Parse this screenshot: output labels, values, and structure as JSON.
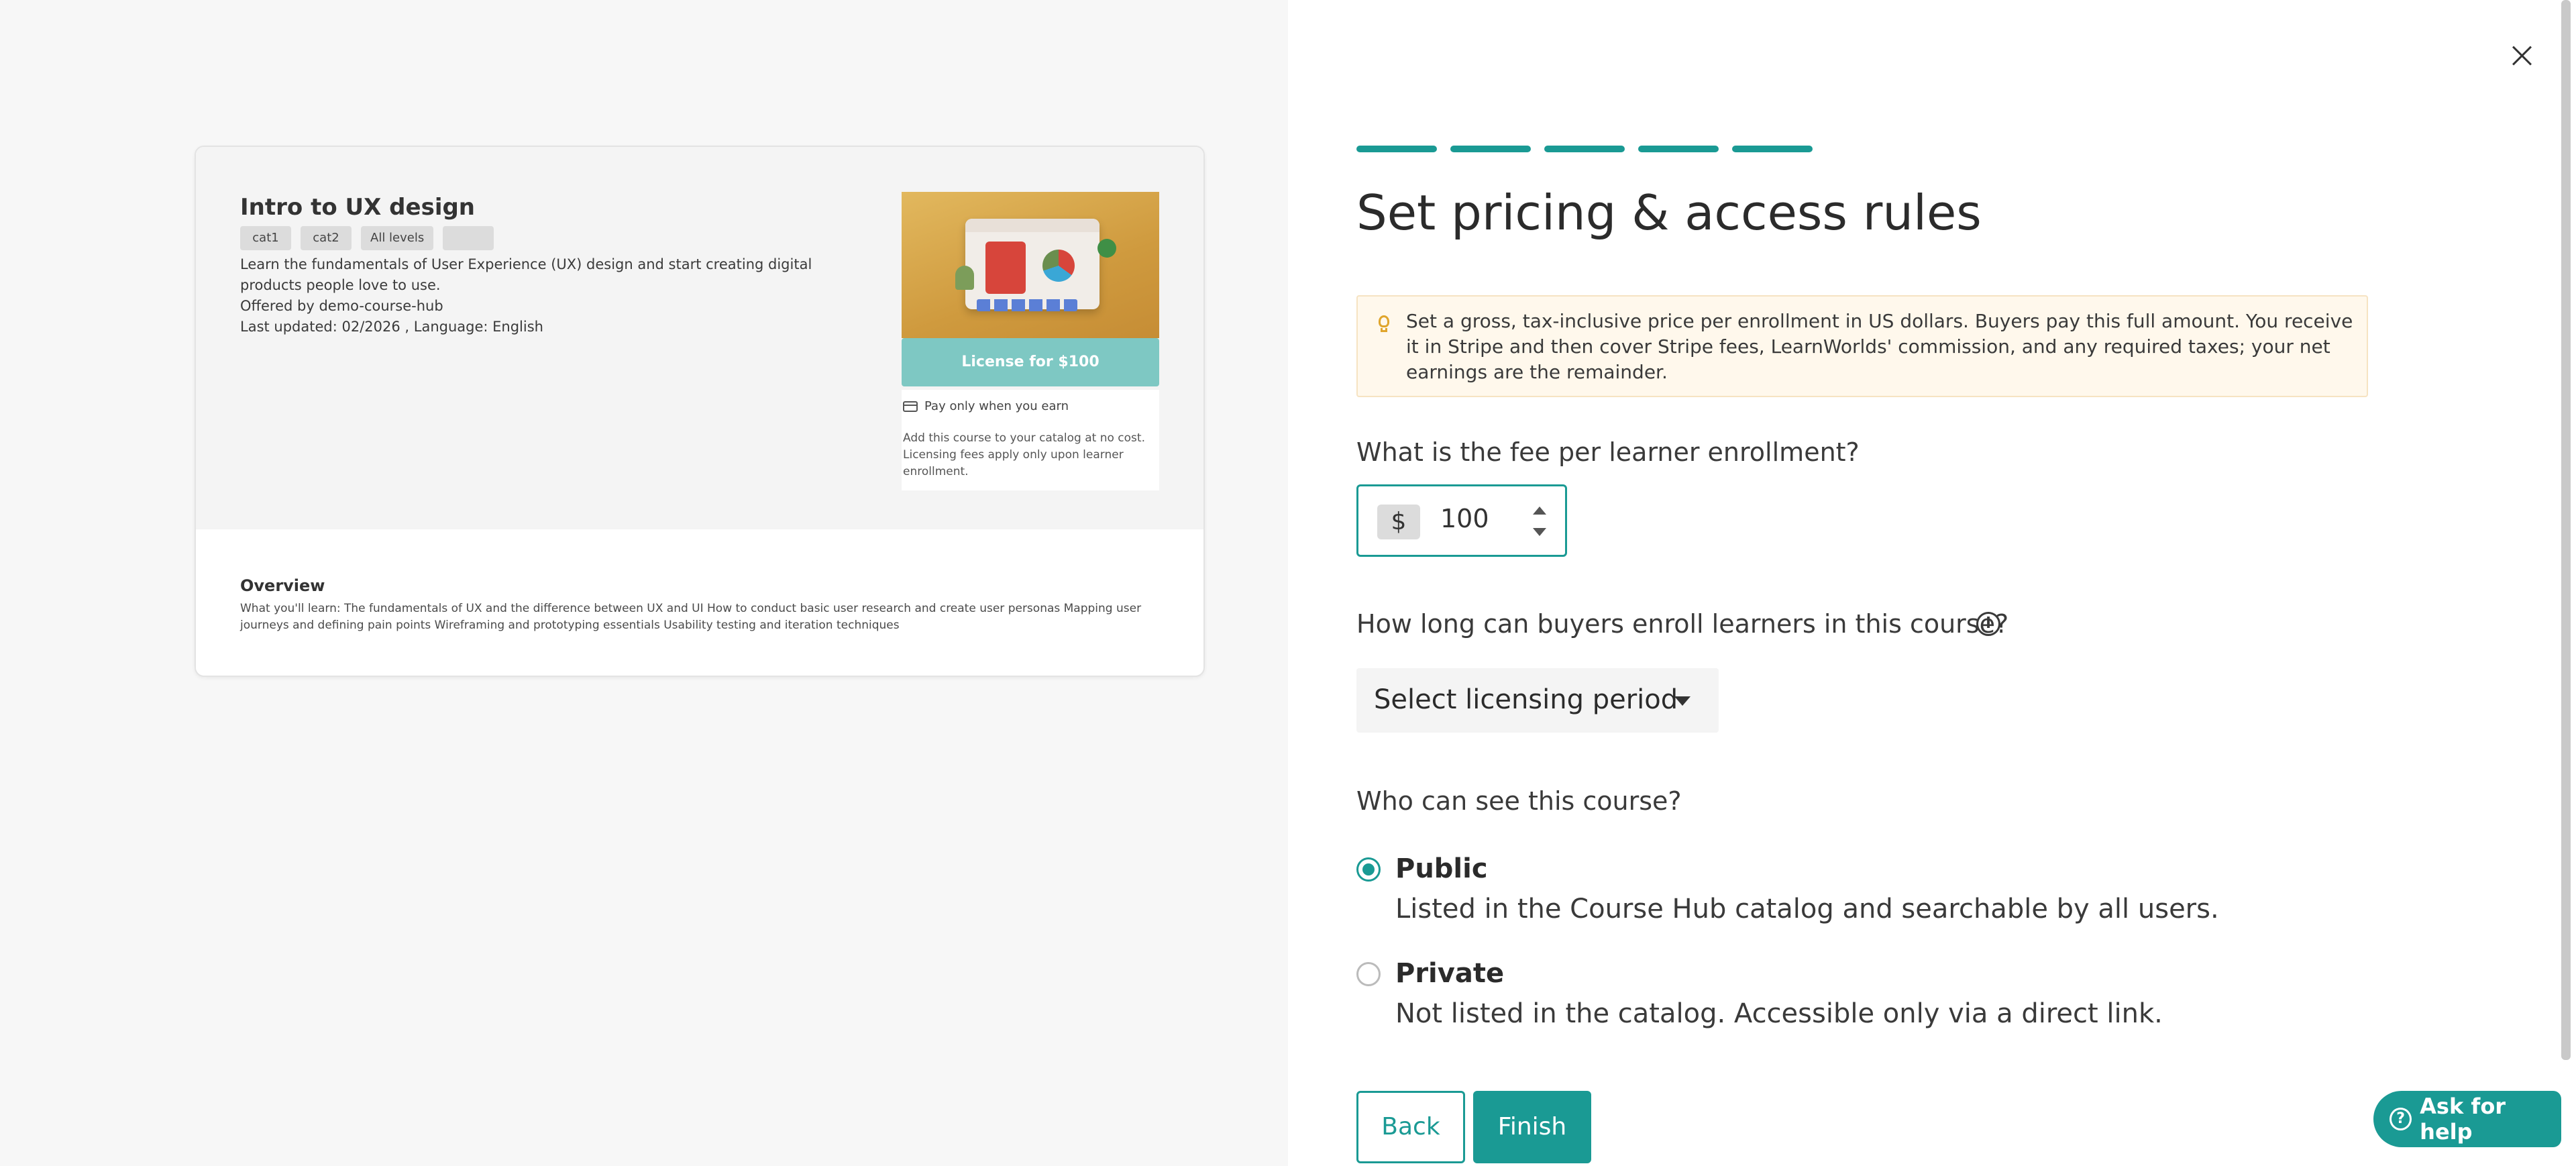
{
  "preview": {
    "title": "Intro to UX design",
    "tags": [
      "cat1",
      "cat2",
      "All levels",
      ""
    ],
    "description": "Learn the fundamentals of User Experience (UX) design and start creating digital products people love to use.",
    "offered_by": "Offered by demo-course-hub",
    "last_updated": "Last updated: 02/2026 , Language: English",
    "license_button": "License for $100",
    "pay_label": "Pay only when you earn",
    "pay_note": "Add this course to your catalog at no cost. Licensing fees apply only upon learner enrollment.",
    "overview_title": "Overview",
    "overview_text": "What you'll learn: The fundamentals of UX and the difference between UX and UI How to conduct basic user research and create user personas Mapping user journeys and defining pain points Wireframing and prototyping essentials Usability testing and iteration techniques"
  },
  "wizard": {
    "steps_total": 5,
    "steps_completed": 5,
    "title": "Set pricing & access rules",
    "tip": "Set a gross, tax-inclusive price per enrollment in US dollars. Buyers pay this full amount. You receive it in Stripe and then cover Stripe fees, LearnWorlds' commission, and any required taxes; your net earnings are the remainder.",
    "fee_label": "What is the fee per learner enrollment?",
    "currency_symbol": "$",
    "fee_value": "100",
    "period_label": "How long can buyers enroll learners in this course?",
    "period_info_icon": "i",
    "period_select": "Select licensing period",
    "visibility_label": "Who can see this course?",
    "visibility_options": [
      {
        "title": "Public",
        "desc": "Listed in the Course Hub catalog and searchable by all users.",
        "selected": true
      },
      {
        "title": "Private",
        "desc": "Not listed in the catalog. Accessible only via a direct link.",
        "selected": false
      }
    ],
    "back_label": "Back",
    "finish_label": "Finish"
  },
  "help": {
    "label": "Ask for help",
    "icon_glyph": "?"
  },
  "colors": {
    "accent": "#1a9a94",
    "tip_bg": "#fff8ec",
    "license_button": "#7ec8c3"
  }
}
